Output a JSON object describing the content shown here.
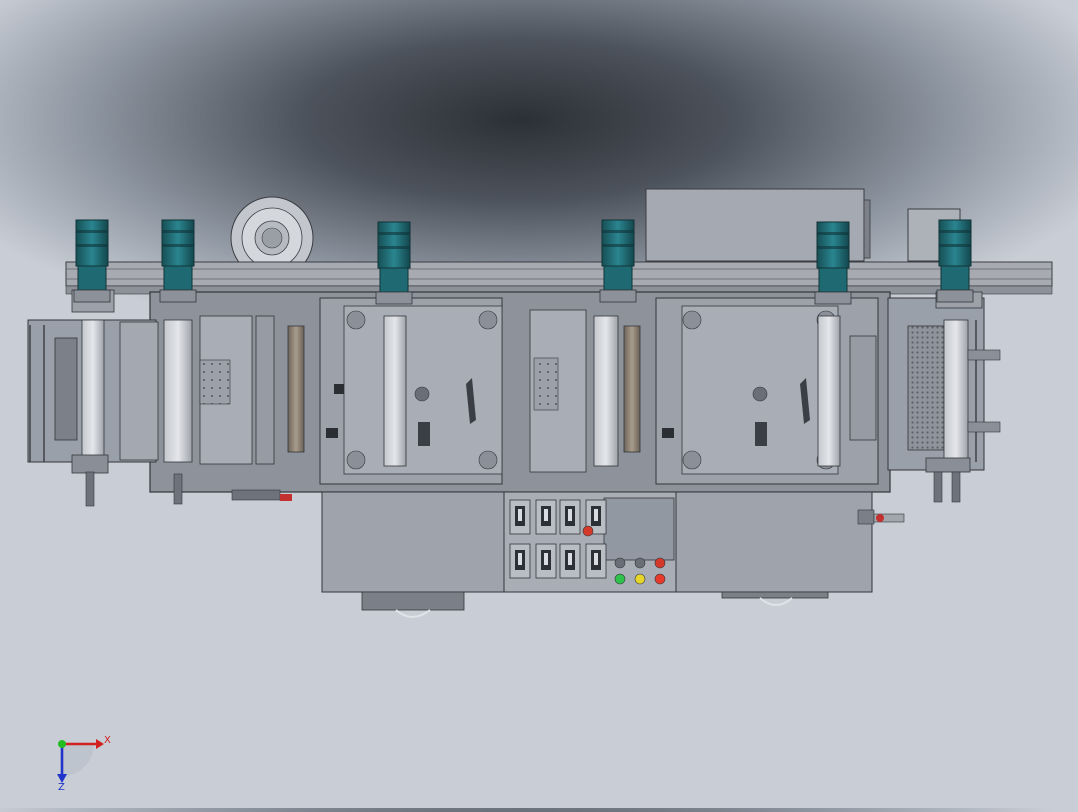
{
  "viewport": {
    "background_top": "#2c3036",
    "background_bottom": "#c9ced6"
  },
  "machine": {
    "frame_color": "#8d929b",
    "panel_color": "#9ea3ac",
    "motor_color": "#1f6a72",
    "rail_color": "#a7aab1",
    "mesh_color": "#6f747c",
    "motor_count": 6,
    "switch_count": 8,
    "indicator_lights": [
      {
        "name": "green-light",
        "color": "#2fc24a"
      },
      {
        "name": "yellow-light",
        "color": "#e6d52a"
      },
      {
        "name": "red-light",
        "color": "#e63a2a"
      }
    ]
  },
  "triad": {
    "x_label": "X",
    "z_label": "Z",
    "x_color": "#d22020",
    "z_color": "#2233cc",
    "y_color": "#22bb22"
  }
}
